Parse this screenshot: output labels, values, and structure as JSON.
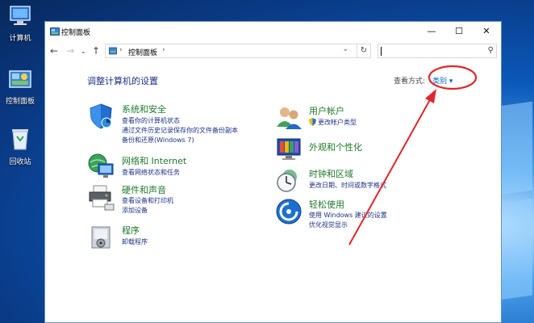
{
  "desktop": {
    "icons": [
      {
        "label": "计算机",
        "icon": "computer-icon"
      },
      {
        "label": "控制面板",
        "icon": "control-panel-icon"
      },
      {
        "label": "回收站",
        "icon": "recycle-bin-icon"
      }
    ]
  },
  "window": {
    "title": "控制面板",
    "controls": {
      "minimize": "—",
      "maximize": "☐",
      "close": "✕"
    },
    "address": {
      "path": "控制面板",
      "refresh": "↻",
      "dropdown": "⌄"
    },
    "search": {
      "placeholder": ""
    },
    "heading": "调整计算机的设置",
    "view_by": {
      "label": "查看方式:",
      "value": "类别 ▾"
    },
    "categories_left": [
      {
        "title": "系统和安全",
        "icon": "shield-icon",
        "links": [
          "查看你的计算机状态",
          "通过文件历史记录保存你的文件备份副本",
          "备份和还原(Windows 7)"
        ]
      },
      {
        "title": "网络和 Internet",
        "icon": "network-icon",
        "links": [
          "查看网络状态和任务"
        ]
      },
      {
        "title": "硬件和声音",
        "icon": "printer-icon",
        "links": [
          "查看设备和打印机",
          "添加设备"
        ]
      },
      {
        "title": "程序",
        "icon": "programs-icon",
        "links": [
          "卸载程序"
        ]
      }
    ],
    "categories_right": [
      {
        "title": "用户帐户",
        "icon": "users-icon",
        "links": [
          "更改帐户类型"
        ]
      },
      {
        "title": "外观和个性化",
        "icon": "appearance-icon",
        "links": []
      },
      {
        "title": "时钟和区域",
        "icon": "clock-icon",
        "links": [
          "更改日期、时间或数字格式"
        ]
      },
      {
        "title": "轻松使用",
        "icon": "ease-of-access-icon",
        "links": [
          "使用 Windows 建议的设置",
          "优化视觉显示"
        ]
      }
    ]
  },
  "colors": {
    "annotation": "#e0262a",
    "category_title": "#1d7b2a",
    "link": "#1e3287"
  }
}
